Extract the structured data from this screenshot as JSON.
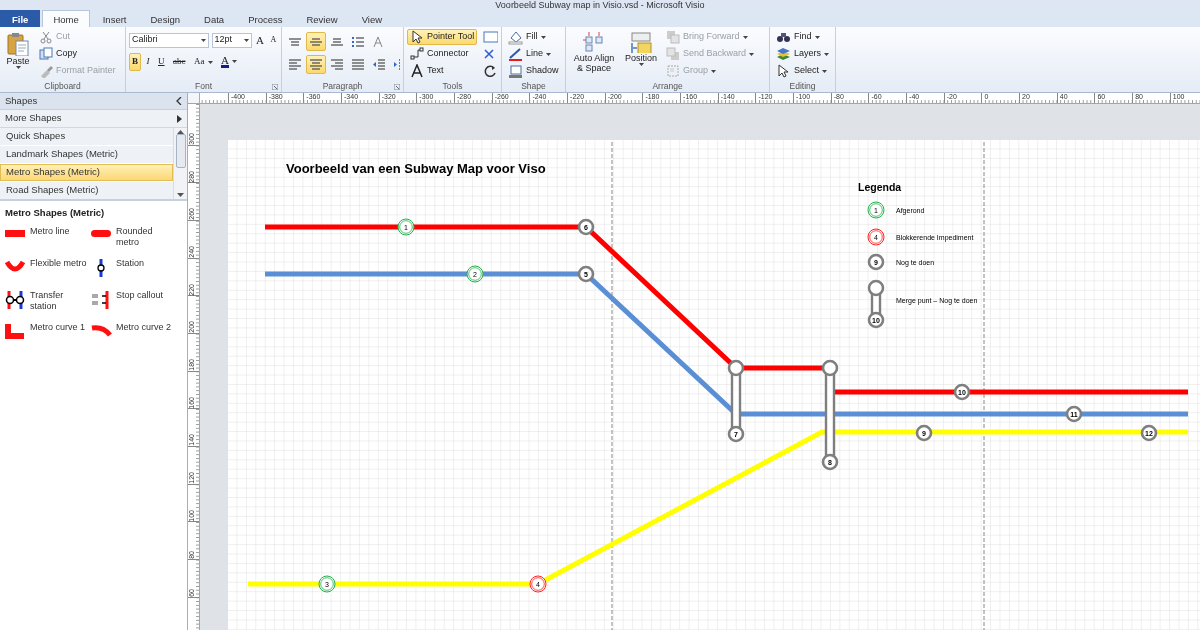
{
  "window": {
    "title": "Voorbeeld Subway map in Visio.vsd - Microsoft Visio"
  },
  "tabs": [
    {
      "label": "File",
      "kind": "file",
      "selected": false
    },
    {
      "label": "Home",
      "kind": "tab",
      "selected": true
    },
    {
      "label": "Insert",
      "kind": "tab",
      "selected": false
    },
    {
      "label": "Design",
      "kind": "tab",
      "selected": false
    },
    {
      "label": "Data",
      "kind": "tab",
      "selected": false
    },
    {
      "label": "Process",
      "kind": "tab",
      "selected": false
    },
    {
      "label": "Review",
      "kind": "tab",
      "selected": false
    },
    {
      "label": "View",
      "kind": "tab",
      "selected": false
    }
  ],
  "ribbon": {
    "clipboard": {
      "label": "Clipboard",
      "paste": "Paste",
      "items": [
        {
          "label": "Cut",
          "disabled": true
        },
        {
          "label": "Copy",
          "disabled": false
        },
        {
          "label": "Format Painter",
          "disabled": true
        }
      ]
    },
    "font": {
      "label": "Font",
      "family": "Calibri",
      "size": "12pt",
      "grow": "A",
      "shrink": "A",
      "color_button": "A",
      "styles": [
        {
          "label": "B",
          "kind": "bold",
          "selected": true
        },
        {
          "label": "I",
          "kind": "italic",
          "selected": false
        },
        {
          "label": "U",
          "kind": "underline",
          "selected": false
        },
        {
          "label": "abc",
          "kind": "strike",
          "selected": false
        },
        {
          "label": "Aa",
          "kind": "case",
          "selected": false
        }
      ]
    },
    "paragraph": {
      "label": "Paragraph",
      "rows": [
        [
          {
            "kind": "align-top",
            "selected": false
          },
          {
            "kind": "align-middle",
            "selected": true
          },
          {
            "kind": "align-bottom",
            "selected": false
          },
          {
            "kind": "bullets",
            "selected": false
          },
          {
            "kind": "text-size",
            "selected": false
          }
        ],
        [
          {
            "kind": "align-left",
            "selected": false
          },
          {
            "kind": "align-center",
            "selected": true
          },
          {
            "kind": "align-right",
            "selected": false
          },
          {
            "kind": "justify",
            "selected": false
          },
          {
            "kind": "outdent",
            "selected": false
          },
          {
            "kind": "indent",
            "selected": false
          }
        ]
      ]
    },
    "tools": {
      "label": "Tools",
      "items": [
        {
          "label": "Pointer Tool",
          "selected": true
        },
        {
          "label": "Connector",
          "selected": false
        },
        {
          "label": "Text",
          "selected": false
        }
      ]
    },
    "shape": {
      "label": "Shape",
      "items": [
        "Fill",
        "Line",
        "Shadow"
      ]
    },
    "arrange": {
      "label": "Arrange",
      "align": "Auto Align & Space",
      "position": "Position",
      "items": [
        {
          "label": "Bring Forward",
          "disabled": true
        },
        {
          "label": "Send Backward",
          "disabled": true
        },
        {
          "label": "Group",
          "disabled": true
        }
      ]
    },
    "editing": {
      "label": "Editing",
      "items": [
        "Find",
        "Layers",
        "Select"
      ]
    }
  },
  "shapes_panel": {
    "title": "Shapes",
    "more": "More Shapes",
    "stencils": [
      {
        "label": "Quick Shapes",
        "selected": false
      },
      {
        "label": "Landmark Shapes (Metric)",
        "selected": false
      },
      {
        "label": "Metro Shapes (Metric)",
        "selected": true
      },
      {
        "label": "Road Shapes (Metric)",
        "selected": false
      }
    ],
    "stencil_title": "Metro Shapes (Metric)",
    "masters": [
      "Metro line",
      "Rounded metro",
      "Flexible metro",
      "Station",
      "Transfer station",
      "Stop callout",
      "Metro curve 1",
      "Metro curve 2"
    ]
  },
  "ruler_horizontal": [
    "-400",
    "-380",
    "-360",
    "-340",
    "-320",
    "-300",
    "-280",
    "-260",
    "-240",
    "-220",
    "-200",
    "-180",
    "-160",
    "-140",
    "-120",
    "-100",
    "-80",
    "-60",
    "-40",
    "-20",
    "0",
    "20",
    "40",
    "60",
    "80",
    "100"
  ],
  "ruler_vertical": [
    "300",
    "280",
    "260",
    "240",
    "220",
    "200",
    "180",
    "160",
    "140",
    "120",
    "100",
    "80",
    "60"
  ],
  "drawing": {
    "title": "Voorbeeld van een Subway Map voor Viso",
    "legend": {
      "title": "Legenda",
      "items": [
        {
          "kind": "done",
          "number": "1",
          "label": "Afgerond"
        },
        {
          "kind": "blocked",
          "number": "4",
          "label": "Blokkerende Impediment"
        },
        {
          "kind": "todo",
          "number": "9",
          "label": "Nog te doen"
        },
        {
          "kind": "merge",
          "number": "10",
          "label": "Merge punt – Nog te doen"
        }
      ]
    },
    "lines": [
      {
        "color": "#ff0000"
      },
      {
        "color": "#5b8fd5"
      },
      {
        "color": "#ffff00"
      }
    ],
    "stations": [
      {
        "number": "1",
        "kind": "done"
      },
      {
        "number": "2",
        "kind": "done"
      },
      {
        "number": "3",
        "kind": "done"
      },
      {
        "number": "4",
        "kind": "blocked"
      },
      {
        "number": "5",
        "kind": "todo"
      },
      {
        "number": "6",
        "kind": "todo"
      },
      {
        "number": "7",
        "kind": "merge"
      },
      {
        "number": "8",
        "kind": "merge"
      },
      {
        "number": "9",
        "kind": "todo"
      },
      {
        "number": "10",
        "kind": "todo"
      },
      {
        "number": "11",
        "kind": "todo"
      },
      {
        "number": "12",
        "kind": "todo"
      }
    ]
  }
}
